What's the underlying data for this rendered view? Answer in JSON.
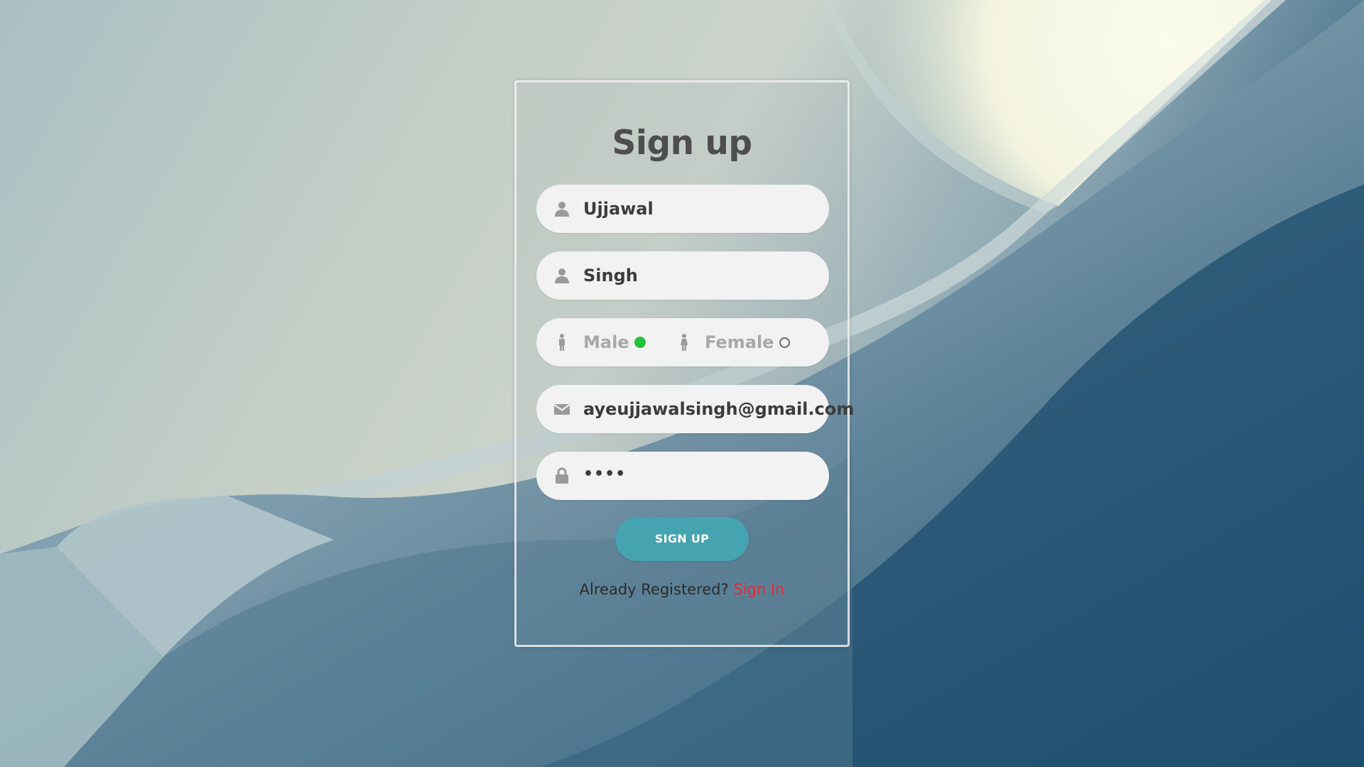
{
  "page": {
    "title": "Sign up"
  },
  "form": {
    "first_name": {
      "value": "Ujjawal",
      "icon": "user-icon"
    },
    "last_name": {
      "value": "Singh",
      "icon": "user-icon"
    },
    "gender": {
      "options": [
        {
          "label": "Male",
          "icon": "male-icon",
          "selected": true
        },
        {
          "label": "Female",
          "icon": "female-icon",
          "selected": false
        }
      ]
    },
    "email": {
      "value": "ayeujjawalsingh@gmail.com",
      "icon": "envelope-icon"
    },
    "password": {
      "value": "••••",
      "icon": "lock-icon"
    },
    "submit_label": "SIGN UP"
  },
  "footer": {
    "prompt": "Already Registered?",
    "link_label": "Sign In"
  },
  "colors": {
    "accent": "#46a3b0",
    "selected_radio": "#22c33a",
    "link": "#e8293a",
    "field_bg": "#f2f2f2"
  }
}
